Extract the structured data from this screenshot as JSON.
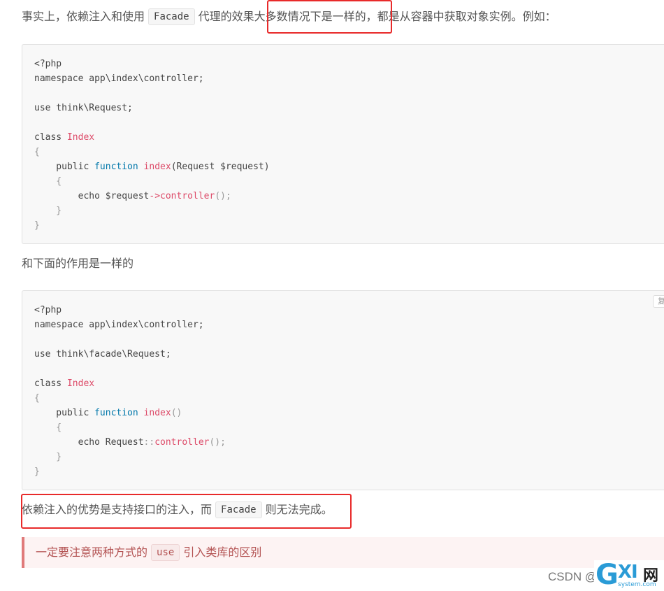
{
  "paragraph1": {
    "before": "事实上，依赖注入和使用",
    "code": "Facade",
    "after": "代理的效果大多数情况下是一样的，都是从容器中获取对象实例。例如："
  },
  "code_block1": {
    "lines": [
      [
        {
          "t": "<?php"
        }
      ],
      [
        {
          "t": "namespace app\\index\\controller;"
        }
      ],
      [],
      [
        {
          "t": "use think\\Request;"
        }
      ],
      [],
      [
        {
          "t": "class "
        },
        {
          "t": "Index",
          "c": "f"
        }
      ],
      [
        {
          "t": "{",
          "c": "pn"
        }
      ],
      [
        {
          "t": "    public "
        },
        {
          "t": "function",
          "c": "k"
        },
        {
          "t": " "
        },
        {
          "t": "index",
          "c": "f"
        },
        {
          "t": "(Request $request)"
        }
      ],
      [
        {
          "t": "    {",
          "c": "pn"
        }
      ],
      [
        {
          "t": "        echo $request"
        },
        {
          "t": "->",
          "c": "f"
        },
        {
          "t": "controller",
          "c": "f"
        },
        {
          "t": "();",
          "c": "pn"
        }
      ],
      [
        {
          "t": "    }",
          "c": "pn"
        }
      ],
      [
        {
          "t": "}",
          "c": "pn"
        }
      ]
    ]
  },
  "paragraph2": "和下面的作用是一样的",
  "code_block2": {
    "copy_label": "复制",
    "lines": [
      [
        {
          "t": "<?php"
        }
      ],
      [
        {
          "t": "namespace app\\index\\controller;"
        }
      ],
      [],
      [
        {
          "t": "use think\\facade\\Request;"
        }
      ],
      [],
      [
        {
          "t": "class "
        },
        {
          "t": "Index",
          "c": "f"
        }
      ],
      [
        {
          "t": "{",
          "c": "pn"
        }
      ],
      [
        {
          "t": "    public "
        },
        {
          "t": "function",
          "c": "k"
        },
        {
          "t": " "
        },
        {
          "t": "index",
          "c": "f"
        },
        {
          "t": "()",
          "c": "pn"
        }
      ],
      [
        {
          "t": "    {",
          "c": "pn"
        }
      ],
      [
        {
          "t": "        echo Request"
        },
        {
          "t": "::",
          "c": "pn"
        },
        {
          "t": "controller",
          "c": "f"
        },
        {
          "t": "();",
          "c": "pn"
        }
      ],
      [
        {
          "t": "    }",
          "c": "pn"
        }
      ],
      [
        {
          "t": "}",
          "c": "pn"
        }
      ]
    ]
  },
  "paragraph3": {
    "before": "依赖注入的优势是支持接口的注入，而",
    "code": "Facade",
    "after": "则无法完成。"
  },
  "tip": {
    "before": "一定要注意两种方式的",
    "code": "use",
    "after": "引入类库的区别"
  },
  "watermark": "CSDN @",
  "logo": {
    "g": "G",
    "xi": "XI",
    "wang": "网",
    "site": "system.com"
  },
  "colors": {
    "highlight": "#e82a2a",
    "keyword": "#0077aa",
    "function": "#dd4a68"
  }
}
